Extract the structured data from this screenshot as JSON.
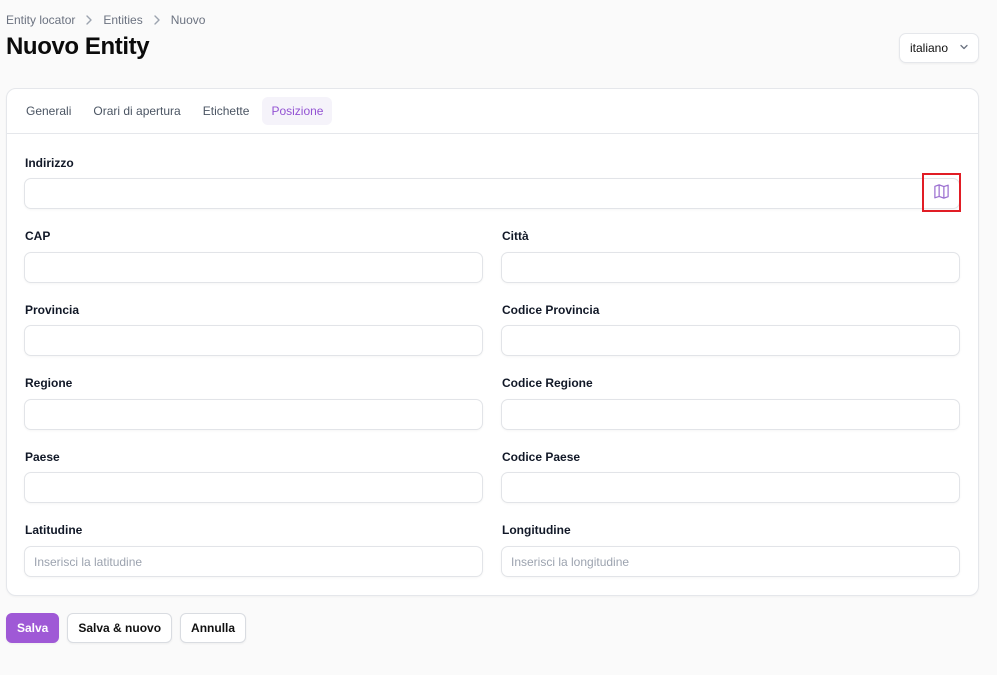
{
  "breadcrumb": [
    "Entity locator",
    "Entities",
    "Nuovo"
  ],
  "page_title": "Nuovo Entity",
  "language_select": {
    "value": "italiano"
  },
  "tabs": [
    {
      "label": "Generali",
      "active": false
    },
    {
      "label": "Orari di apertura",
      "active": false
    },
    {
      "label": "Etichette",
      "active": false
    },
    {
      "label": "Posizione",
      "active": true
    }
  ],
  "fields": {
    "indirizzo": {
      "label": "Indirizzo",
      "value": "",
      "placeholder": ""
    },
    "cap": {
      "label": "CAP",
      "value": "",
      "placeholder": ""
    },
    "citta": {
      "label": "Città",
      "value": "",
      "placeholder": ""
    },
    "provincia": {
      "label": "Provincia",
      "value": "",
      "placeholder": ""
    },
    "codice_provincia": {
      "label": "Codice Provincia",
      "value": "",
      "placeholder": ""
    },
    "regione": {
      "label": "Regione",
      "value": "",
      "placeholder": ""
    },
    "codice_regione": {
      "label": "Codice Regione",
      "value": "",
      "placeholder": ""
    },
    "paese": {
      "label": "Paese",
      "value": "",
      "placeholder": ""
    },
    "codice_paese": {
      "label": "Codice Paese",
      "value": "",
      "placeholder": ""
    },
    "latitudine": {
      "label": "Latitudine",
      "value": "",
      "placeholder": "Inserisci la latitudine"
    },
    "longitudine": {
      "label": "Longitudine",
      "value": "",
      "placeholder": "Inserisci la longitudine"
    }
  },
  "actions": {
    "save": "Salva",
    "save_new": "Salva & nuovo",
    "cancel": "Annulla"
  },
  "icons": {
    "map_button": "map-icon",
    "chevron_right": "chevron-right-icon",
    "chevron_down": "chevron-down-icon"
  },
  "colors": {
    "accent": "#9f59d6",
    "highlight": "#e11d25"
  }
}
